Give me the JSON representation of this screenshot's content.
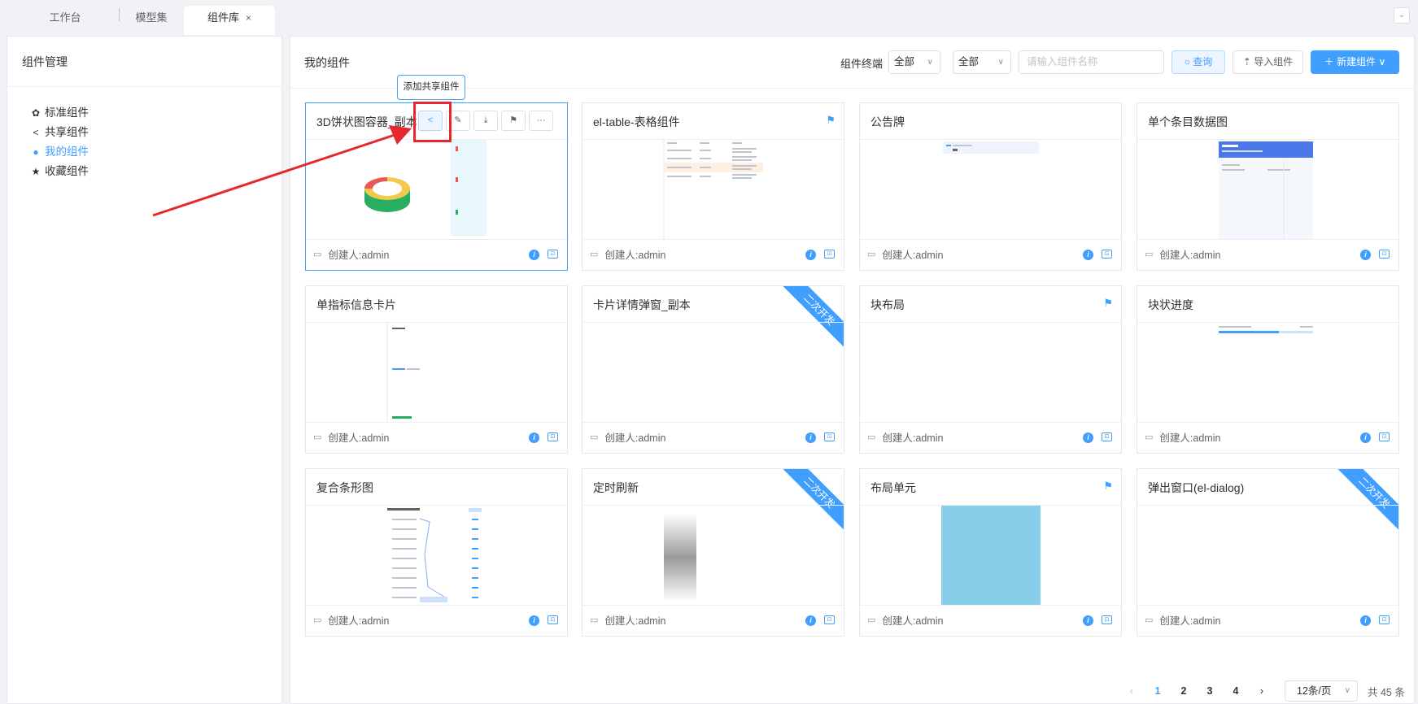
{
  "tabs": [
    {
      "label": "工作台"
    },
    {
      "label": "模型集"
    },
    {
      "label": "组件库",
      "close": "×"
    }
  ],
  "tabs_menu_icon": "chevron-down-icon",
  "sidebar": {
    "title": "组件管理",
    "items": [
      {
        "label": "标准组件",
        "icon": "gear-icon"
      },
      {
        "label": "共享组件",
        "icon": "share-icon"
      },
      {
        "label": "我的组件",
        "icon": "user-icon",
        "active": true
      },
      {
        "label": "收藏组件",
        "icon": "star-icon"
      }
    ]
  },
  "main": {
    "title": "我的组件",
    "filter_label": "组件终端",
    "select1": "全部",
    "select2": "全部",
    "search_placeholder": "请输入组件名称",
    "query_label": "查询",
    "import_label": "导入组件",
    "new_label": "新建组件"
  },
  "tooltip": "添加共享组件",
  "creator_label": "创建人:admin",
  "ribbon_label": "二次开发",
  "cards": [
    {
      "title": "3D饼状图容器_副本"
    },
    {
      "title": "el-table-表格组件"
    },
    {
      "title": "公告牌"
    },
    {
      "title": "单个条目数据图"
    },
    {
      "title": "单指标信息卡片"
    },
    {
      "title": "卡片详情弹窗_副本"
    },
    {
      "title": "块布局"
    },
    {
      "title": "块状进度"
    },
    {
      "title": "复合条形图"
    },
    {
      "title": "定时刷新"
    },
    {
      "title": "布局单元"
    },
    {
      "title": "弹出窗口(el-dialog)"
    }
  ],
  "pagination": {
    "pages": [
      "1",
      "2",
      "3",
      "4"
    ],
    "page_size": "12条/页",
    "total": "共 45 条"
  }
}
